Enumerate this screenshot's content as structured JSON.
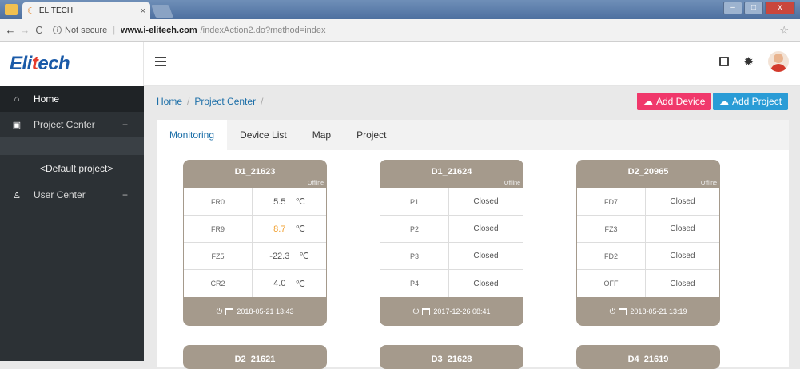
{
  "browser": {
    "tab_title": "ELITECH",
    "tab_close": "×",
    "not_secure": "Not secure",
    "url_domain": "www.i-elitech.com",
    "url_path": "/indexAction2.do?method=index"
  },
  "app": {
    "logo_main": "Eli",
    "logo_accent": "t",
    "logo_end": "ech"
  },
  "sidebar": {
    "items": [
      {
        "label": "Home",
        "icon": "home-icon"
      },
      {
        "label": "Project Center",
        "toggle": "−",
        "icon": "grid-icon"
      },
      {
        "label": "User Center",
        "toggle": "+",
        "icon": "user-icon"
      }
    ],
    "sub_item": "<Default project>"
  },
  "breadcrumb": {
    "home": "Home",
    "current": "Project Center",
    "sep": "/"
  },
  "buttons": {
    "add_device": "Add Device",
    "add_project": "Add Project"
  },
  "tabs": [
    "Monitoring",
    "Device List",
    "Map",
    "Project"
  ],
  "cards": [
    {
      "name": "D1_21623",
      "status": "Offline",
      "rows": [
        {
          "label": "FR0",
          "value": "5.5",
          "unit": "℃"
        },
        {
          "label": "FR9",
          "value": "8.7",
          "unit": "℃",
          "warn": true
        },
        {
          "label": "FZ5",
          "value": "-22.3",
          "unit": "℃"
        },
        {
          "label": "CR2",
          "value": "4.0",
          "unit": "℃"
        }
      ],
      "time": "2018-05-21 13:43"
    },
    {
      "name": "D1_21624",
      "status": "Offline",
      "rows": [
        {
          "label": "P1",
          "value": "Closed"
        },
        {
          "label": "P2",
          "value": "Closed"
        },
        {
          "label": "P3",
          "value": "Closed"
        },
        {
          "label": "P4",
          "value": "Closed"
        }
      ],
      "time": "2017-12-26 08:41"
    },
    {
      "name": "D2_20965",
      "status": "Offline",
      "rows": [
        {
          "label": "FD7",
          "value": "Closed"
        },
        {
          "label": "FZ3",
          "value": "Closed"
        },
        {
          "label": "FD2",
          "value": "Closed"
        },
        {
          "label": "OFF",
          "value": "Closed"
        }
      ],
      "time": "2018-05-21 13:19"
    }
  ],
  "next_cards": [
    "D2_21621",
    "D3_21628",
    "D4_21619"
  ]
}
